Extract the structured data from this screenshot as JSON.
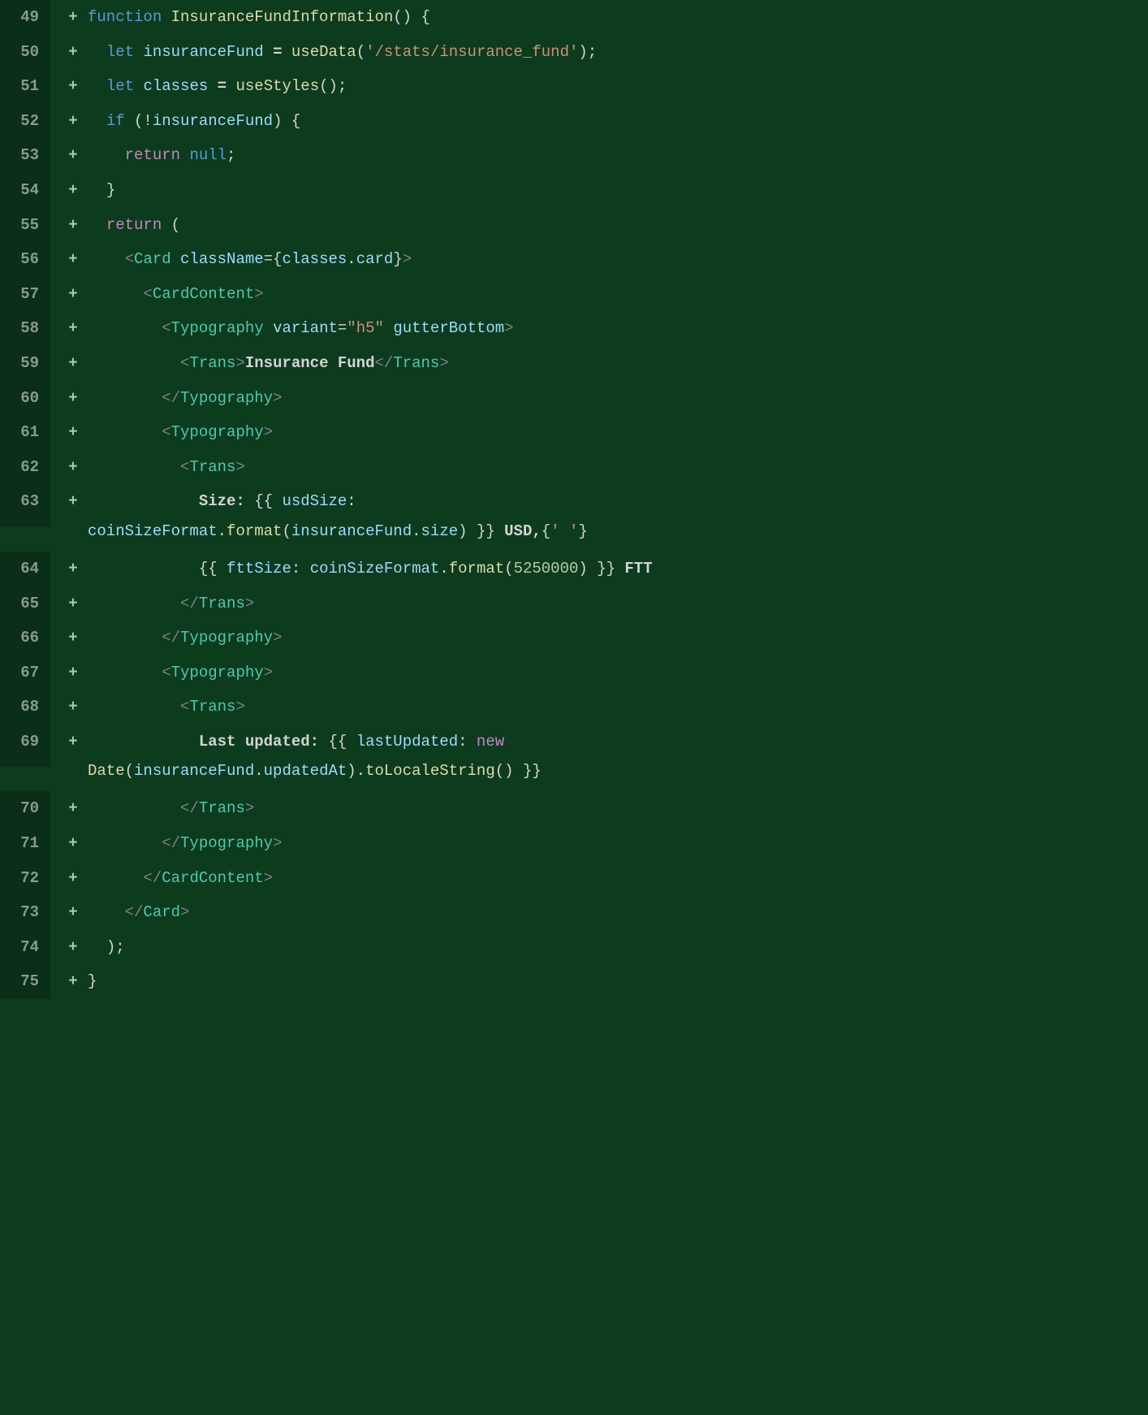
{
  "lines": [
    {
      "num": "49",
      "marker": "+",
      "tokens": [
        {
          "cls": "kw-function",
          "t": "function"
        },
        {
          "cls": "plain",
          "t": " "
        },
        {
          "cls": "fn-name",
          "t": "InsuranceFundInformation"
        },
        {
          "cls": "punct",
          "t": "()"
        },
        {
          "cls": "plain",
          "t": " "
        },
        {
          "cls": "punct",
          "t": "{"
        }
      ]
    },
    {
      "num": "50",
      "marker": "+",
      "indent": "  ",
      "tokens": [
        {
          "cls": "kw-let",
          "t": "let"
        },
        {
          "cls": "plain",
          "t": " "
        },
        {
          "cls": "var",
          "t": "insuranceFund"
        },
        {
          "cls": "plain",
          "t": " = "
        },
        {
          "cls": "fn-call",
          "t": "useData"
        },
        {
          "cls": "punct",
          "t": "("
        },
        {
          "cls": "string",
          "t": "'/stats/insurance_fund'"
        },
        {
          "cls": "punct",
          "t": ");"
        }
      ]
    },
    {
      "num": "51",
      "marker": "+",
      "indent": "  ",
      "tokens": [
        {
          "cls": "kw-let",
          "t": "let"
        },
        {
          "cls": "plain",
          "t": " "
        },
        {
          "cls": "var",
          "t": "classes"
        },
        {
          "cls": "plain",
          "t": " = "
        },
        {
          "cls": "fn-call",
          "t": "useStyles"
        },
        {
          "cls": "punct",
          "t": "();"
        }
      ]
    },
    {
      "num": "52",
      "marker": "+",
      "indent": "  ",
      "tokens": [
        {
          "cls": "kw-if",
          "t": "if"
        },
        {
          "cls": "plain",
          "t": " "
        },
        {
          "cls": "punct",
          "t": "(!"
        },
        {
          "cls": "var",
          "t": "insuranceFund"
        },
        {
          "cls": "punct",
          "t": ")"
        },
        {
          "cls": "plain",
          "t": " "
        },
        {
          "cls": "punct",
          "t": "{"
        }
      ]
    },
    {
      "num": "53",
      "marker": "+",
      "indent": "    ",
      "tokens": [
        {
          "cls": "kw-return",
          "t": "return"
        },
        {
          "cls": "plain",
          "t": " "
        },
        {
          "cls": "kw-null",
          "t": "null"
        },
        {
          "cls": "punct",
          "t": ";"
        }
      ]
    },
    {
      "num": "54",
      "marker": "+",
      "indent": "  ",
      "tokens": [
        {
          "cls": "punct",
          "t": "}"
        }
      ]
    },
    {
      "num": "55",
      "marker": "+",
      "indent": "  ",
      "tokens": [
        {
          "cls": "kw-return",
          "t": "return"
        },
        {
          "cls": "plain",
          "t": " "
        },
        {
          "cls": "punct",
          "t": "("
        }
      ]
    },
    {
      "num": "56",
      "marker": "+",
      "indent": "    ",
      "tokens": [
        {
          "cls": "jsx-bracket",
          "t": "<"
        },
        {
          "cls": "jsx-tag",
          "t": "Card"
        },
        {
          "cls": "plain",
          "t": " "
        },
        {
          "cls": "jsx-attr",
          "t": "className"
        },
        {
          "cls": "punct",
          "t": "={"
        },
        {
          "cls": "var",
          "t": "classes"
        },
        {
          "cls": "punct",
          "t": "."
        },
        {
          "cls": "prop",
          "t": "card"
        },
        {
          "cls": "punct",
          "t": "}"
        },
        {
          "cls": "jsx-bracket",
          "t": ">"
        }
      ]
    },
    {
      "num": "57",
      "marker": "+",
      "indent": "      ",
      "tokens": [
        {
          "cls": "jsx-bracket",
          "t": "<"
        },
        {
          "cls": "jsx-tag",
          "t": "CardContent"
        },
        {
          "cls": "jsx-bracket",
          "t": ">"
        }
      ]
    },
    {
      "num": "58",
      "marker": "+",
      "indent": "        ",
      "tokens": [
        {
          "cls": "jsx-bracket",
          "t": "<"
        },
        {
          "cls": "jsx-tag",
          "t": "Typography"
        },
        {
          "cls": "plain",
          "t": " "
        },
        {
          "cls": "jsx-attr",
          "t": "variant"
        },
        {
          "cls": "punct",
          "t": "="
        },
        {
          "cls": "string",
          "t": "\"h5\""
        },
        {
          "cls": "plain",
          "t": " "
        },
        {
          "cls": "jsx-attr",
          "t": "gutterBottom"
        },
        {
          "cls": "jsx-bracket",
          "t": ">"
        }
      ]
    },
    {
      "num": "59",
      "marker": "+",
      "indent": "          ",
      "tokens": [
        {
          "cls": "jsx-bracket",
          "t": "<"
        },
        {
          "cls": "jsx-tag",
          "t": "Trans"
        },
        {
          "cls": "jsx-bracket",
          "t": ">"
        },
        {
          "cls": "jsx-text",
          "t": "Insurance Fund"
        },
        {
          "cls": "jsx-bracket",
          "t": "</"
        },
        {
          "cls": "jsx-tag",
          "t": "Trans"
        },
        {
          "cls": "jsx-bracket",
          "t": ">"
        }
      ]
    },
    {
      "num": "60",
      "marker": "+",
      "indent": "        ",
      "tokens": [
        {
          "cls": "jsx-bracket",
          "t": "</"
        },
        {
          "cls": "jsx-tag",
          "t": "Typography"
        },
        {
          "cls": "jsx-bracket",
          "t": ">"
        }
      ]
    },
    {
      "num": "61",
      "marker": "+",
      "indent": "        ",
      "tokens": [
        {
          "cls": "jsx-bracket",
          "t": "<"
        },
        {
          "cls": "jsx-tag",
          "t": "Typography"
        },
        {
          "cls": "jsx-bracket",
          "t": ">"
        }
      ]
    },
    {
      "num": "62",
      "marker": "+",
      "indent": "          ",
      "tokens": [
        {
          "cls": "jsx-bracket",
          "t": "<"
        },
        {
          "cls": "jsx-tag",
          "t": "Trans"
        },
        {
          "cls": "jsx-bracket",
          "t": ">"
        }
      ]
    },
    {
      "num": "63",
      "marker": "+",
      "indent": "            ",
      "tokens": [
        {
          "cls": "jsx-text",
          "t": "Size: "
        },
        {
          "cls": "punct",
          "t": "{{ "
        },
        {
          "cls": "var",
          "t": "usdSize"
        },
        {
          "cls": "punct",
          "t": ":"
        }
      ],
      "wrap": {
        "indent": "",
        "tokens": [
          {
            "cls": "var",
            "t": "coinSizeFormat"
          },
          {
            "cls": "punct",
            "t": "."
          },
          {
            "cls": "method",
            "t": "format"
          },
          {
            "cls": "punct",
            "t": "("
          },
          {
            "cls": "var",
            "t": "insuranceFund"
          },
          {
            "cls": "punct",
            "t": "."
          },
          {
            "cls": "prop",
            "t": "size"
          },
          {
            "cls": "punct",
            "t": ") }}"
          },
          {
            "cls": "jsx-text",
            "t": " USD,"
          },
          {
            "cls": "punct",
            "t": "{"
          },
          {
            "cls": "string",
            "t": "' '"
          },
          {
            "cls": "punct",
            "t": "}"
          }
        ]
      }
    },
    {
      "num": "64",
      "marker": "+",
      "indent": "            ",
      "tokens": [
        {
          "cls": "punct",
          "t": "{{ "
        },
        {
          "cls": "var",
          "t": "fttSize"
        },
        {
          "cls": "punct",
          "t": ": "
        },
        {
          "cls": "var",
          "t": "coinSizeFormat"
        },
        {
          "cls": "punct",
          "t": "."
        },
        {
          "cls": "method",
          "t": "format"
        },
        {
          "cls": "punct",
          "t": "("
        },
        {
          "cls": "num",
          "t": "5250000"
        },
        {
          "cls": "punct",
          "t": ") }}"
        },
        {
          "cls": "jsx-text",
          "t": " FTT"
        }
      ]
    },
    {
      "num": "65",
      "marker": "+",
      "indent": "          ",
      "tokens": [
        {
          "cls": "jsx-bracket",
          "t": "</"
        },
        {
          "cls": "jsx-tag",
          "t": "Trans"
        },
        {
          "cls": "jsx-bracket",
          "t": ">"
        }
      ]
    },
    {
      "num": "66",
      "marker": "+",
      "indent": "        ",
      "tokens": [
        {
          "cls": "jsx-bracket",
          "t": "</"
        },
        {
          "cls": "jsx-tag",
          "t": "Typography"
        },
        {
          "cls": "jsx-bracket",
          "t": ">"
        }
      ]
    },
    {
      "num": "67",
      "marker": "+",
      "indent": "        ",
      "tokens": [
        {
          "cls": "jsx-bracket",
          "t": "<"
        },
        {
          "cls": "jsx-tag",
          "t": "Typography"
        },
        {
          "cls": "jsx-bracket",
          "t": ">"
        }
      ]
    },
    {
      "num": "68",
      "marker": "+",
      "indent": "          ",
      "tokens": [
        {
          "cls": "jsx-bracket",
          "t": "<"
        },
        {
          "cls": "jsx-tag",
          "t": "Trans"
        },
        {
          "cls": "jsx-bracket",
          "t": ">"
        }
      ]
    },
    {
      "num": "69",
      "marker": "+",
      "indent": "            ",
      "tokens": [
        {
          "cls": "jsx-text",
          "t": "Last updated: "
        },
        {
          "cls": "punct",
          "t": "{{ "
        },
        {
          "cls": "var",
          "t": "lastUpdated"
        },
        {
          "cls": "punct",
          "t": ": "
        },
        {
          "cls": "kw-new",
          "t": "new"
        }
      ],
      "wrap": {
        "indent": "",
        "tokens": [
          {
            "cls": "fn-call",
            "t": "Date"
          },
          {
            "cls": "punct",
            "t": "("
          },
          {
            "cls": "var",
            "t": "insuranceFund"
          },
          {
            "cls": "punct",
            "t": "."
          },
          {
            "cls": "prop",
            "t": "updatedAt"
          },
          {
            "cls": "punct",
            "t": ")."
          },
          {
            "cls": "method",
            "t": "toLocaleString"
          },
          {
            "cls": "punct",
            "t": "() }}"
          }
        ]
      }
    },
    {
      "num": "70",
      "marker": "+",
      "indent": "          ",
      "tokens": [
        {
          "cls": "jsx-bracket",
          "t": "</"
        },
        {
          "cls": "jsx-tag",
          "t": "Trans"
        },
        {
          "cls": "jsx-bracket",
          "t": ">"
        }
      ]
    },
    {
      "num": "71",
      "marker": "+",
      "indent": "        ",
      "tokens": [
        {
          "cls": "jsx-bracket",
          "t": "</"
        },
        {
          "cls": "jsx-tag",
          "t": "Typography"
        },
        {
          "cls": "jsx-bracket",
          "t": ">"
        }
      ]
    },
    {
      "num": "72",
      "marker": "+",
      "indent": "      ",
      "tokens": [
        {
          "cls": "jsx-bracket",
          "t": "</"
        },
        {
          "cls": "jsx-tag",
          "t": "CardContent"
        },
        {
          "cls": "jsx-bracket",
          "t": ">"
        }
      ]
    },
    {
      "num": "73",
      "marker": "+",
      "indent": "    ",
      "tokens": [
        {
          "cls": "jsx-bracket",
          "t": "</"
        },
        {
          "cls": "jsx-tag",
          "t": "Card"
        },
        {
          "cls": "jsx-bracket",
          "t": ">"
        }
      ]
    },
    {
      "num": "74",
      "marker": "+",
      "indent": "  ",
      "tokens": [
        {
          "cls": "punct",
          "t": ");"
        }
      ]
    },
    {
      "num": "75",
      "marker": "+",
      "tokens": [
        {
          "cls": "punct",
          "t": "}"
        }
      ]
    }
  ]
}
